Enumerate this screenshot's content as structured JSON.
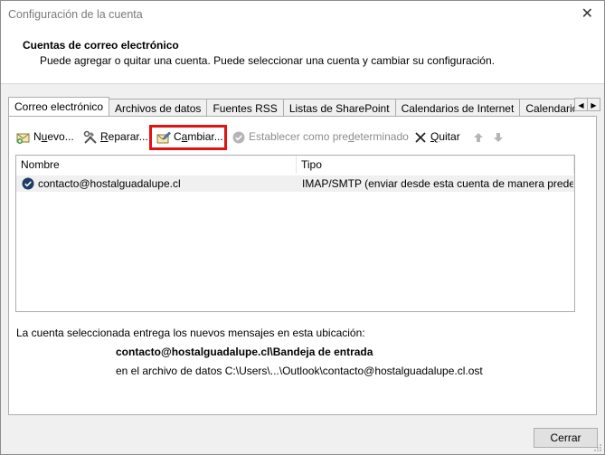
{
  "window": {
    "title": "Configuración de la cuenta"
  },
  "header": {
    "title": "Cuentas de correo electrónico",
    "subtitle": "Puede agregar o quitar una cuenta. Puede seleccionar una cuenta y cambiar su configuración."
  },
  "tabs": [
    {
      "label": "Correo electrónico",
      "active": true
    },
    {
      "label": "Archivos de datos"
    },
    {
      "label": "Fuentes RSS"
    },
    {
      "label": "Listas de SharePoint"
    },
    {
      "label": "Calendarios de Internet"
    },
    {
      "label": "Calendarios publicados"
    }
  ],
  "toolbar": {
    "new": {
      "label_pre": "N",
      "label_ul": "u",
      "label_post": "evo..."
    },
    "repair": {
      "label_pre": "",
      "label_ul": "R",
      "label_post": "eparar..."
    },
    "change": {
      "label_pre": "C",
      "label_ul": "a",
      "label_post": "mbiar..."
    },
    "set_default": {
      "label_pre": "Establecer como pre",
      "label_ul": "d",
      "label_post": "eterminado"
    },
    "remove": {
      "label_pre": "",
      "label_ul": "Q",
      "label_post": "uitar"
    }
  },
  "table": {
    "columns": [
      "Nombre",
      "Tipo"
    ],
    "rows": [
      {
        "name": "contacto@hostalguadalupe.cl",
        "type": "IMAP/SMTP (enviar desde esta cuenta de manera predet..."
      }
    ]
  },
  "delivery": {
    "label": "La cuenta seleccionada entrega los nuevos mensajes en esta ubicación:",
    "folder": "contacto@hostalguadalupe.cl\\Bandeja de entrada",
    "file": "en el archivo de datos C:\\Users\\...\\Outlook\\contacto@hostalguadalupe.cl.ost"
  },
  "buttons": {
    "close": "Cerrar"
  },
  "colors": {
    "highlight": "#e11313",
    "selected_row": "#f0f0f0"
  }
}
